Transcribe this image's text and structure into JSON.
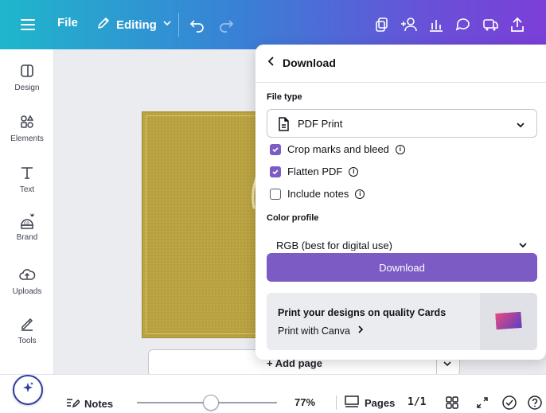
{
  "topbar": {
    "file_label": "File",
    "editing_label": "Editing",
    "icons": [
      "menu-icon",
      "pencil-icon",
      "undo-icon",
      "redo-icon",
      "resize-icon",
      "share-people-icon",
      "insights-icon",
      "comment-icon",
      "present-icon",
      "share-upload-icon"
    ]
  },
  "sidebar": {
    "items": [
      {
        "label": "Design",
        "icon": "design-icon"
      },
      {
        "label": "Elements",
        "icon": "elements-icon"
      },
      {
        "label": "Text",
        "icon": "text-icon"
      },
      {
        "label": "Brand",
        "icon": "brand-icon"
      },
      {
        "label": "Uploads",
        "icon": "uploads-icon"
      },
      {
        "label": "Tools",
        "icon": "tools-icon"
      }
    ]
  },
  "canvas": {
    "add_page_label": "+ Add page"
  },
  "download_panel": {
    "title": "Download",
    "file_type_label": "File type",
    "file_type_value": "PDF Print",
    "options": [
      {
        "label": "Crop marks and bleed",
        "checked": true
      },
      {
        "label": "Flatten PDF",
        "checked": true
      },
      {
        "label": "Include notes",
        "checked": false
      }
    ],
    "color_profile_label": "Color profile",
    "color_profile_value": "RGB (best for digital use)",
    "download_button": "Download",
    "promo_title": "Print your designs on quality Cards",
    "promo_link": "Print with Canva"
  },
  "bottombar": {
    "notes_label": "Notes",
    "zoom_value": "77%",
    "pages_label": "Pages",
    "page_count": "1/1"
  },
  "colors": {
    "accent": "#7d5bc4",
    "design_gold": "#b8a03e"
  }
}
